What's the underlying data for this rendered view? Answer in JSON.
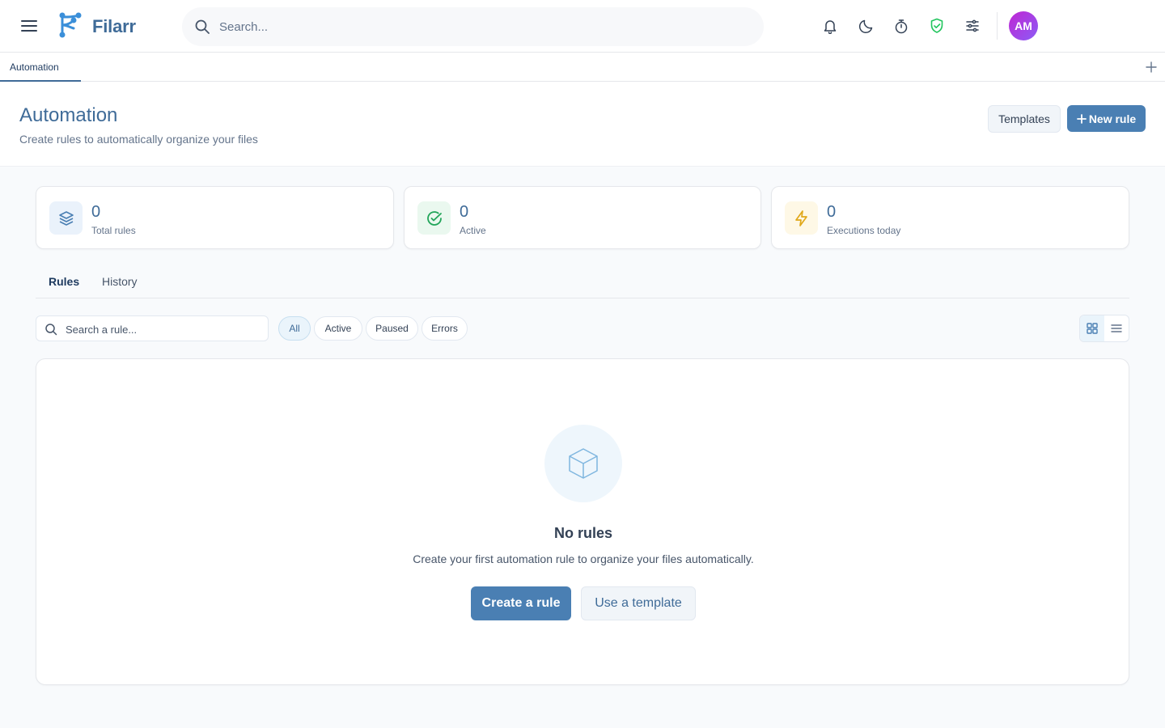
{
  "app": {
    "name": "Filarr"
  },
  "search": {
    "placeholder": "Search..."
  },
  "user": {
    "initials": "AM"
  },
  "tabs": [
    {
      "label": "Automation"
    }
  ],
  "page": {
    "title": "Automation",
    "subtitle": "Create rules to automatically organize your files",
    "templates_label": "Templates",
    "new_rule_label": "New rule"
  },
  "stats": [
    {
      "value": "0",
      "label": "Total rules",
      "icon": "layers-icon"
    },
    {
      "value": "0",
      "label": "Active",
      "icon": "check-circle-icon"
    },
    {
      "value": "0",
      "label": "Executions today",
      "icon": "lightning-icon"
    }
  ],
  "subtabs": [
    {
      "label": "Rules"
    },
    {
      "label": "History"
    }
  ],
  "rule_search": {
    "placeholder": "Search a rule..."
  },
  "filters": [
    "All",
    "Active",
    "Paused",
    "Errors"
  ],
  "empty": {
    "title": "No rules",
    "description": "Create your first automation rule to organize your files automatically.",
    "create_label": "Create a rule",
    "template_label": "Use a template"
  },
  "colors": {
    "accent": "#4a7fb3",
    "brand": "#3f6b98",
    "success": "#22c55e",
    "warning": "#eab308",
    "avatar": "#a855f7"
  }
}
